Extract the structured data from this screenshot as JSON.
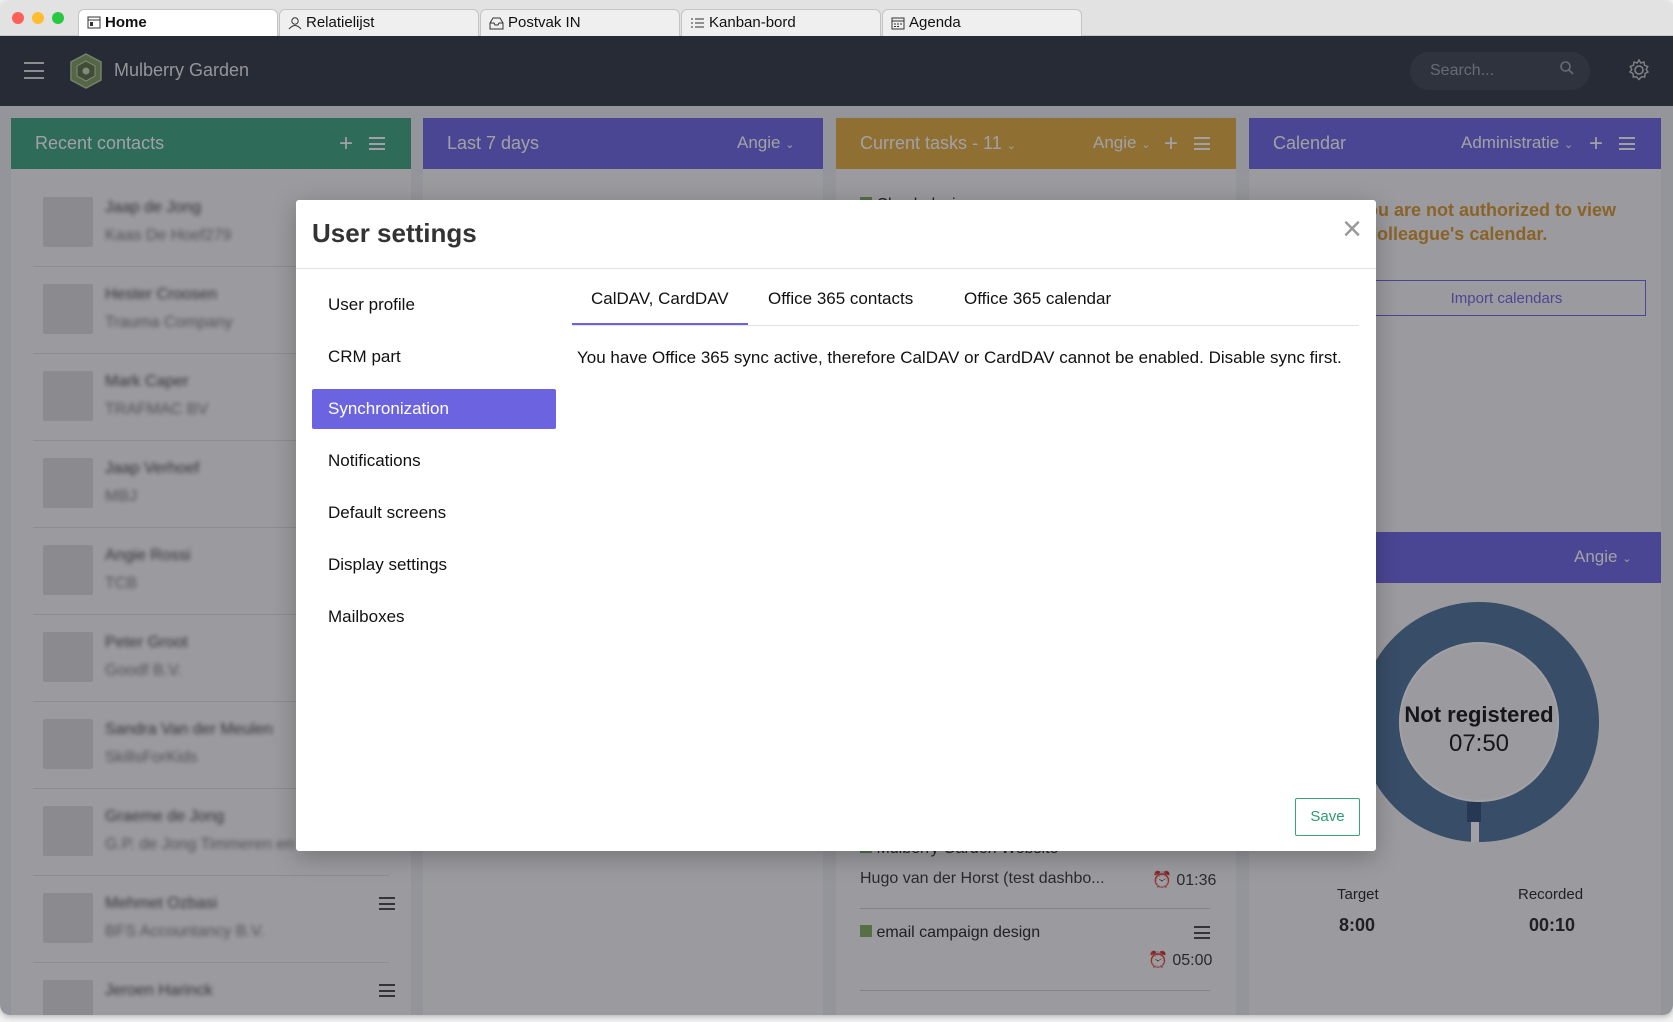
{
  "browser_tabs": [
    "Home",
    "Relatielijst",
    "Postvak IN",
    "Kanban-bord",
    "Agenda"
  ],
  "app": {
    "brand": "Mulberry Garden",
    "search_placeholder": "Search..."
  },
  "columns": {
    "recent_contacts": {
      "title": "Recent contacts"
    },
    "last7": {
      "title": "Last 7 days",
      "user": "Angie"
    },
    "tasks": {
      "title": "Current tasks - 11",
      "user": "Angie"
    },
    "calendar": {
      "title": "Calendar",
      "user": "Administratie",
      "warning": "ou are not authorized to view\ncolleague's calendar.",
      "import_button": "Import calendars"
    }
  },
  "contacts": [
    {
      "name": "Jaap de Jong",
      "company": "Kaas De Hoef279"
    },
    {
      "name": "Hester Croosen",
      "company": "Trauma Company"
    },
    {
      "name": "Mark Caper",
      "company": "TRAFMAC BV"
    },
    {
      "name": "Jaap Verhoef",
      "company": "MBJ"
    },
    {
      "name": "Angie Rossi",
      "company": "TCB"
    },
    {
      "name": "Peter Groot",
      "company": "Goodf B.V."
    },
    {
      "name": "Sandra Van der Meulen",
      "company": "SkillsForKids"
    },
    {
      "name": "Graeme de Jong",
      "company": "G.P. de Jong Timmeren en"
    },
    {
      "name": "Mehmet Ozbasi",
      "company": "BFS Accountancy B.V."
    },
    {
      "name": "Jeroen Harinck",
      "company": ""
    }
  ],
  "tasks": {
    "top_item": "Check design",
    "item1": {
      "title": "Mulberry Garden Website",
      "sub": "Hugo van der Horst (test dashbo...",
      "time": "01:36"
    },
    "item2": {
      "title": "email campaign design",
      "time": "05:00"
    }
  },
  "time_widget": {
    "user": "Angie",
    "status": "Not registered",
    "time": "07:50",
    "target_label": "Target",
    "target_value": "8:00",
    "recorded_label": "Recorded",
    "recorded_value": "00:10"
  },
  "modal": {
    "title": "User settings",
    "close": "×",
    "nav": [
      "User profile",
      "CRM part",
      "Synchronization",
      "Notifications",
      "Default screens",
      "Display settings",
      "Mailboxes"
    ],
    "tabs": [
      "CalDAV, CardDAV",
      "Office 365 contacts",
      "Office 365 calendar"
    ],
    "message": "You have Office 365 sync active, therefore CalDAV or CardDAV cannot be enabled. Disable sync first.",
    "save": "Save"
  },
  "colors": {
    "contacts": "#3aa37a",
    "last7": "#6c63e0",
    "tasks": "#e0a93a",
    "calendar": "#6c63e0",
    "accent": "#6c63e0"
  }
}
